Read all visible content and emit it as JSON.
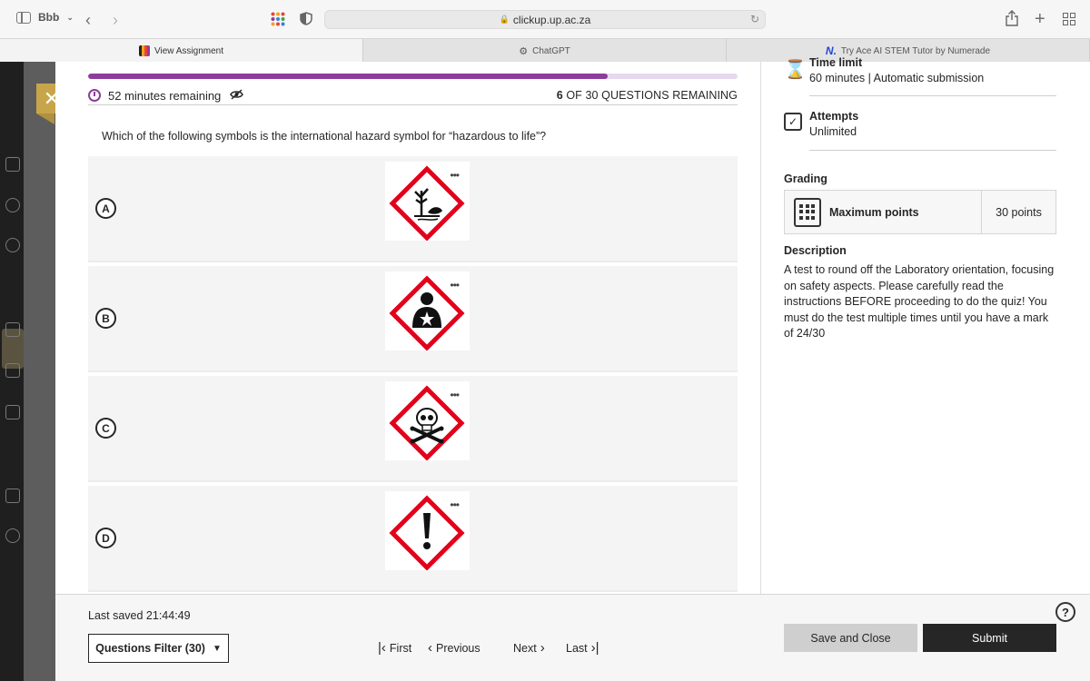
{
  "browser": {
    "profile_label": "Bbb",
    "address": "clickup.up.ac.za",
    "tabs": [
      {
        "label": "View Assignment"
      },
      {
        "label": "ChatGPT"
      },
      {
        "label": "Try Ace AI STEM Tutor by Numerade"
      }
    ]
  },
  "quiz": {
    "progress_fraction": 0.8,
    "timer_text": "52 minutes remaining",
    "remaining_count": "6",
    "remaining_rest": " OF 30 QUESTIONS REMAINING",
    "question": "Which of the following symbols is the international hazard symbol for “hazardous to life”?",
    "options": [
      {
        "letter": "A",
        "symbol": "environment-hazard-pictogram"
      },
      {
        "letter": "B",
        "symbol": "health-hazard-pictogram"
      },
      {
        "letter": "C",
        "symbol": "skull-crossbones-pictogram"
      },
      {
        "letter": "D",
        "symbol": "exclamation-mark-pictogram"
      }
    ]
  },
  "details": {
    "time_limit_title": "Time limit",
    "time_limit_value": "60 minutes | Automatic submission",
    "attempts_title": "Attempts",
    "attempts_value": "Unlimited",
    "grading_title": "Grading",
    "grading_name": "Maximum points",
    "grading_points": "30 points",
    "description_title": "Description",
    "description_text": "A test to round off the Laboratory orientation, focusing on safety aspects. Please carefully read the instructions BEFORE proceeding to do the quiz! You must do the test multiple times until you have a mark of 24/30"
  },
  "footer": {
    "last_saved": "Last saved 21:44:49",
    "filter_label": "Questions Filter (30)",
    "first_label": "First",
    "previous_label": "Previous",
    "next_label": "Next",
    "last_label": "Last",
    "save_close_label": "Save and Close",
    "submit_label": "Submit"
  },
  "colors": {
    "accent": "#8e3c9c",
    "close_button": "#c8a54a",
    "hazard_red": "#e3001b"
  }
}
